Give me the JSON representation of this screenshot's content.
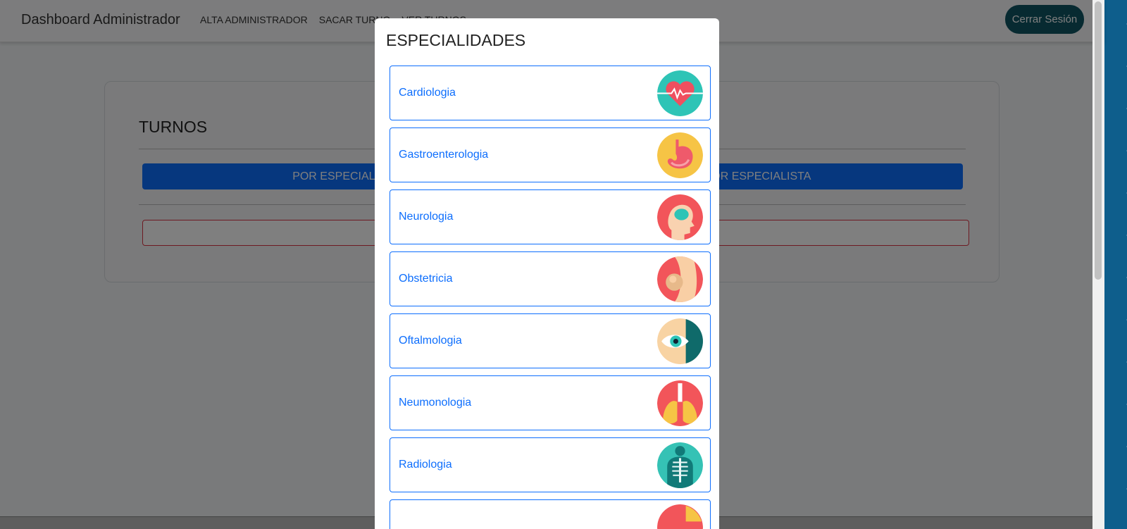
{
  "navbar": {
    "brand": "Dashboard Administrador",
    "links": [
      "ALTA ADMINISTRADOR",
      "SACAR TURNO",
      "VER TURNOS"
    ],
    "logout_label": "Cerrar Sesión"
  },
  "card": {
    "title": "TURNOS",
    "btn_left": "POR ESPECIALIDAD",
    "btn_right": "POR ESPECIALISTA"
  },
  "modal": {
    "title": "ESPECIALIDADES",
    "items": [
      {
        "label": "Cardiologia",
        "icon": "heart-icon",
        "bg": "#2ec4b6"
      },
      {
        "label": "Gastroenterologia",
        "icon": "stomach-icon",
        "bg": "#f6c445"
      },
      {
        "label": "Neurologia",
        "icon": "brain-icon",
        "bg": "#f2555a"
      },
      {
        "label": "Obstetricia",
        "icon": "pregnancy-icon",
        "bg": "#f2555a"
      },
      {
        "label": "Oftalmologia",
        "icon": "eye-icon",
        "bg": "#f8d3a3"
      },
      {
        "label": "Neumonologia",
        "icon": "lungs-icon",
        "bg": "#f2555a"
      },
      {
        "label": "Radiologia",
        "icon": "xray-icon",
        "bg": "#35c2b5"
      },
      {
        "label": "",
        "icon": "specialty-icon",
        "bg": "#f2555a"
      }
    ]
  },
  "colors": {
    "primary": "#0d6efd",
    "logout_bg": "#0f5563",
    "danger": "#dc3545"
  }
}
